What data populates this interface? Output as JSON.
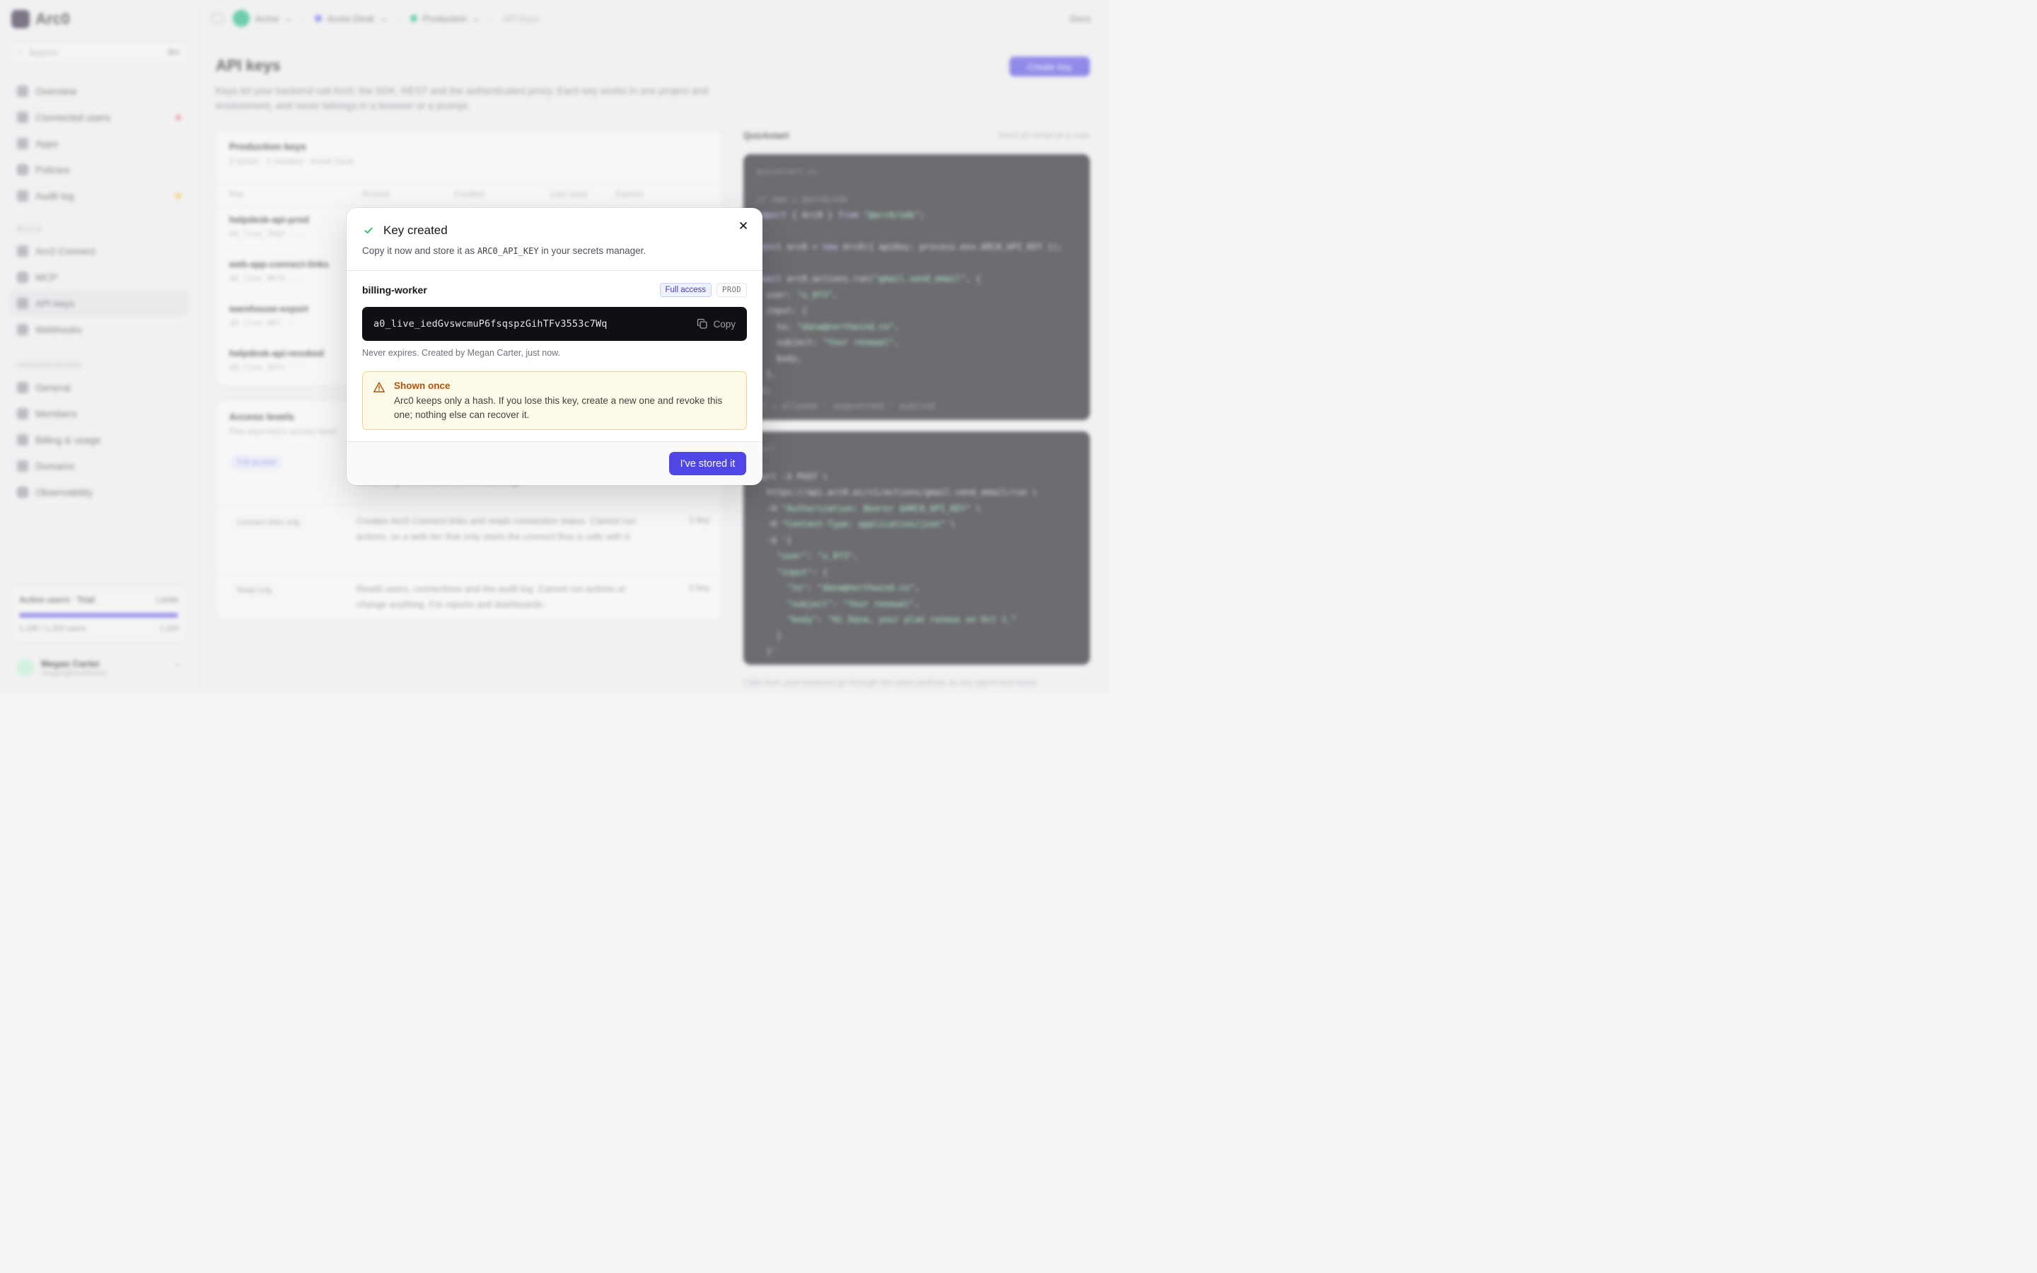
{
  "app": {
    "logo_text": "Arc0",
    "search_placeholder": "Search",
    "search_shortcut": "⌘K",
    "nav_main": [
      "Overview",
      "Connected users",
      "Apps",
      "Policies",
      "Audit log"
    ],
    "section_build": "BUILD",
    "nav_build": [
      "Arc0 Connect",
      "MCP",
      "API keys",
      "Webhooks"
    ],
    "section_org": "ORGANIZATION",
    "nav_org": [
      "General",
      "Members",
      "Billing & usage",
      "Domains",
      "Observability"
    ],
    "usage": {
      "label": "Active users · Trial",
      "right": "Limits",
      "fraction": 0.99,
      "left2": "1,188",
      "mid2": "/ 1,200 users",
      "right2": "1,200"
    },
    "user": {
      "name": "Megan Carter",
      "email": "megan@northwind"
    },
    "breadcrumbs": [
      "Acme",
      "Acme Desk",
      "Production",
      "API keys"
    ],
    "topbar_right": "Docs",
    "page_title": "API keys",
    "page_desc": "Keys let your backend call Arc0: the SDK, REST and the authenticated proxy. Each key works in one project and environment, and never belongs in a browser or a prompt.",
    "create_button": "Create key",
    "keys_card": {
      "title": "Production keys",
      "subtitle": "3 active · 1 revoked · Acme Desk",
      "columns": [
        "Key",
        "Access",
        "Created",
        "Last used",
        "Expires"
      ],
      "rows": [
        {
          "name": "helpdesk-api-prod",
          "prefix": "a0_live_7Hqf ···"
        },
        {
          "name": "web-app-connect-links",
          "prefix": "a0_live_8Kfb ···"
        },
        {
          "name": "warehouse-export",
          "prefix": "a0_live_mE1 ···"
        },
        {
          "name": "helpdesk-api-revoked",
          "prefix": "a0_live_3Vfs ···"
        }
      ]
    },
    "levels_card": {
      "title": "Access levels",
      "subtitle": "Pick each key's access level",
      "rows": [
        {
          "label": "Full access",
          "desc": "Everything: tools, data and the audit log.",
          "count": ""
        },
        {
          "label": "Connect links only",
          "desc": "Creates Arc0 Connect links and reads connection status. Cannot run actions, so a web tier that only starts the connect flow is safe with it.",
          "count": "1 key"
        },
        {
          "label": "Read only",
          "desc": "Reads users, connections and the audit log. Cannot run actions or change anything. For reports and dashboards.",
          "count": "2 key"
        }
      ]
    },
    "snippet": {
      "title": "Quickstart",
      "hint": "Send an email as a user",
      "file1": "quickstart.js",
      "file2": "curl",
      "footer": "Calls from your backend go through the same policies as any agent and every"
    }
  },
  "modal": {
    "title": "Key created",
    "subtitle_before": "Copy it now and store it as ",
    "subtitle_var": "ARC0_API_KEY",
    "subtitle_after": " in your secrets manager.",
    "key_name": "billing-worker",
    "access_tag": "Full access",
    "env_tag": "PROD",
    "key_value": "a0_live_iedGvswcmuP6fsqspzGihTFv3553c7Wq",
    "copy_label": "Copy",
    "meta": "Never expires. Created by Megan Carter, just now.",
    "warning_title": "Shown once",
    "warning_text": "Arc0 keeps only a hash. If you lose this key, create a new one and revoke this one; nothing else can recover it.",
    "confirm_button": "I've stored it"
  },
  "colors": {
    "accent": "#4f46e5",
    "success": "#22c55e",
    "warning": "#b45309"
  }
}
